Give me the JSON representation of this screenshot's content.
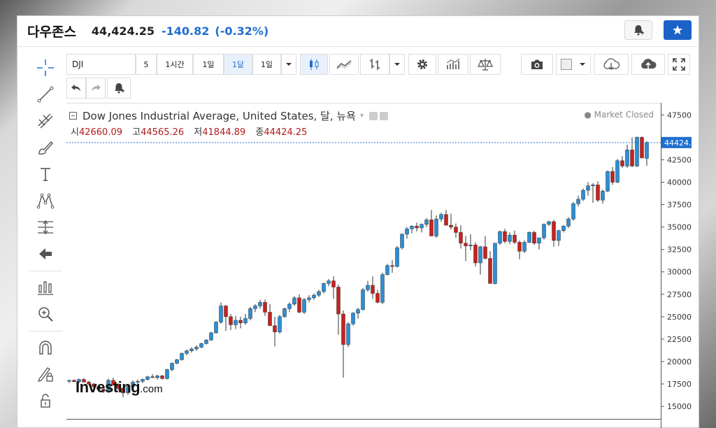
{
  "header": {
    "title": "다우존스",
    "price": "44,424.25",
    "change": "-140.82",
    "change_pct": "(-0.32%)"
  },
  "toolbar": {
    "symbol": "DJI",
    "intervals": [
      "5",
      "1시간",
      "1일",
      "1달",
      "1일"
    ],
    "active_interval": "1달"
  },
  "icons": [
    "crosshair-icon",
    "trend-line-icon",
    "fib-icon",
    "brush-icon",
    "text-icon",
    "pattern-icon",
    "measure-icon",
    "arrow-left-icon",
    "indicators-icon",
    "zoom-icon",
    "magnet-icon",
    "lock-drawing-icon",
    "unlock-icon",
    "undo-icon",
    "redo-icon",
    "alert-icon",
    "star-icon",
    "candles-icon",
    "line-icon",
    "bars-icon",
    "settings-icon",
    "studies-icon",
    "compare-icon",
    "camera-icon",
    "color-icon",
    "cloud-load-icon",
    "cloud-save-icon",
    "fullscreen-icon"
  ],
  "legend": {
    "title": "Dow Jones Industrial Average, United States, 달, 뉴욕",
    "market_status": "Market Closed",
    "open_label": "시",
    "open": "42660.09",
    "high_label": "고",
    "high": "44565.26",
    "low_label": "저",
    "low": "41844.89",
    "close_label": "종",
    "close": "44424.25"
  },
  "brand": {
    "name": "Investing",
    "suffix": ".com"
  },
  "colors": {
    "up": "#2a8fd6",
    "down": "#c8211d",
    "accent": "#1b62c7"
  },
  "chart_data": {
    "type": "candlestick",
    "title": "Dow Jones Industrial Average, United States, 달, 뉴욕",
    "y_ticks": [
      "15000.00",
      "17500.00",
      "20000.00",
      "22500.00",
      "25000.00",
      "27500.00",
      "30000.00",
      "32500.00",
      "35000.00",
      "37500.00",
      "40000.00",
      "42500.00",
      "47500.00"
    ],
    "ylim": [
      13600,
      48700
    ],
    "last_price_label": "44424.25",
    "candles": [
      [
        17800,
        17950,
        17600,
        17900
      ],
      [
        17900,
        18000,
        17700,
        17750
      ],
      [
        17750,
        18100,
        17600,
        18000
      ],
      [
        18000,
        18150,
        17850,
        17700
      ],
      [
        17700,
        17850,
        17400,
        17500
      ],
      [
        17500,
        17600,
        17100,
        17200
      ],
      [
        17200,
        17300,
        16800,
        16900
      ],
      [
        16900,
        17000,
        16500,
        16700
      ],
      [
        16700,
        18100,
        16500,
        17900
      ],
      [
        17900,
        18200,
        17700,
        17400
      ],
      [
        17400,
        17600,
        16800,
        17000
      ],
      [
        17000,
        17200,
        16000,
        16500
      ],
      [
        16500,
        17400,
        16300,
        17200
      ],
      [
        17200,
        17900,
        17000,
        17700
      ],
      [
        17700,
        18000,
        17500,
        17800
      ],
      [
        17800,
        18100,
        17600,
        18000
      ],
      [
        18000,
        18400,
        17900,
        18300
      ],
      [
        18300,
        18600,
        18200,
        18200
      ],
      [
        18200,
        18500,
        18000,
        18400
      ],
      [
        18400,
        18500,
        18000,
        18100
      ],
      [
        18100,
        19200,
        18000,
        19100
      ],
      [
        19100,
        19900,
        18900,
        19800
      ],
      [
        19800,
        20300,
        19700,
        20200
      ],
      [
        20200,
        21000,
        20100,
        20900
      ],
      [
        20900,
        21300,
        20700,
        21200
      ],
      [
        21200,
        21600,
        21000,
        21400
      ],
      [
        21400,
        21800,
        21200,
        21600
      ],
      [
        21600,
        22100,
        21500,
        22000
      ],
      [
        22000,
        22500,
        21900,
        22400
      ],
      [
        22400,
        23300,
        22300,
        23200
      ],
      [
        23200,
        24500,
        23100,
        24400
      ],
      [
        24400,
        26600,
        24200,
        26200
      ],
      [
        26200,
        26300,
        23400,
        25000
      ],
      [
        25000,
        25300,
        23500,
        24100
      ],
      [
        24100,
        25100,
        23600,
        24600
      ],
      [
        24600,
        25000,
        23700,
        24300
      ],
      [
        24300,
        25300,
        24100,
        24800
      ],
      [
        24800,
        26100,
        24600,
        25900
      ],
      [
        25900,
        26400,
        25500,
        26200
      ],
      [
        26200,
        26900,
        25900,
        26600
      ],
      [
        26600,
        26900,
        25100,
        25500
      ],
      [
        25500,
        26400,
        24400,
        24000
      ],
      [
        24000,
        25000,
        21700,
        23300
      ],
      [
        23300,
        25200,
        23100,
        25000
      ],
      [
        25000,
        26000,
        24900,
        25900
      ],
      [
        25900,
        26600,
        25500,
        26400
      ],
      [
        26400,
        27300,
        26200,
        27100
      ],
      [
        27100,
        27500,
        25400,
        25500
      ],
      [
        25500,
        27100,
        25300,
        26900
      ],
      [
        26900,
        27400,
        26600,
        27100
      ],
      [
        27100,
        27600,
        26900,
        27400
      ],
      [
        27400,
        28000,
        27200,
        27800
      ],
      [
        27800,
        28800,
        27600,
        28700
      ],
      [
        28700,
        29200,
        28400,
        29000
      ],
      [
        29000,
        29500,
        27000,
        28300
      ],
      [
        28300,
        28600,
        23000,
        25300
      ],
      [
        25300,
        25700,
        18200,
        21900
      ],
      [
        21900,
        24400,
        21600,
        24200
      ],
      [
        24200,
        25500,
        24000,
        25400
      ],
      [
        25400,
        26000,
        24800,
        25800
      ],
      [
        25800,
        28200,
        25700,
        28000
      ],
      [
        28000,
        29000,
        27800,
        28500
      ],
      [
        28500,
        29500,
        27000,
        27600
      ],
      [
        27600,
        28000,
        26500,
        26600
      ],
      [
        26600,
        29900,
        26400,
        29700
      ],
      [
        29700,
        30900,
        29600,
        30700
      ],
      [
        30700,
        31300,
        29900,
        30600
      ],
      [
        30600,
        32900,
        30500,
        32700
      ],
      [
        32700,
        34300,
        32500,
        34200
      ],
      [
        34200,
        35000,
        33700,
        34800
      ],
      [
        34800,
        35200,
        34300,
        35100
      ],
      [
        35100,
        35500,
        34500,
        34900
      ],
      [
        34900,
        35400,
        34400,
        35300
      ],
      [
        35300,
        36000,
        35000,
        35800
      ],
      [
        35800,
        36900,
        35500,
        34000
      ],
      [
        34000,
        36300,
        33800,
        35900
      ],
      [
        35900,
        36600,
        35600,
        36400
      ],
      [
        36400,
        36900,
        35800,
        35200
      ],
      [
        35200,
        36500,
        34700,
        35000
      ],
      [
        35000,
        35400,
        33800,
        34400
      ],
      [
        34400,
        35200,
        32600,
        33200
      ],
      [
        33200,
        34000,
        31200,
        32900
      ],
      [
        32900,
        34200,
        32400,
        33000
      ],
      [
        33000,
        33300,
        30600,
        31000
      ],
      [
        31000,
        32900,
        29700,
        32800
      ],
      [
        32800,
        34000,
        31400,
        31500
      ],
      [
        31500,
        32300,
        28700,
        28700
      ],
      [
        28700,
        33000,
        28600,
        33200
      ],
      [
        33200,
        34600,
        33000,
        34500
      ],
      [
        34500,
        34800,
        33200,
        33400
      ],
      [
        33400,
        34400,
        33100,
        34100
      ],
      [
        34100,
        34600,
        33100,
        33300
      ],
      [
        33300,
        33500,
        31400,
        32300
      ],
      [
        32300,
        33500,
        32100,
        33300
      ],
      [
        33300,
        34500,
        33200,
        34400
      ],
      [
        34400,
        34600,
        33000,
        33200
      ],
      [
        33200,
        33700,
        32500,
        33800
      ],
      [
        33800,
        35400,
        33600,
        35300
      ],
      [
        35300,
        35700,
        35100,
        35600
      ],
      [
        35600,
        35800,
        32800,
        33500
      ],
      [
        33500,
        34700,
        32900,
        34600
      ],
      [
        34600,
        35200,
        34400,
        35100
      ],
      [
        35100,
        36100,
        34900,
        35900
      ],
      [
        35900,
        37800,
        35700,
        37600
      ],
      [
        37600,
        38500,
        37300,
        38100
      ],
      [
        38100,
        39300,
        37900,
        39100
      ],
      [
        39100,
        40000,
        38500,
        39600
      ],
      [
        39600,
        39900,
        37700,
        39700
      ],
      [
        39700,
        40100,
        37800,
        38000
      ],
      [
        38000,
        39200,
        37600,
        39000
      ],
      [
        39000,
        41300,
        38900,
        41200
      ],
      [
        41200,
        41700,
        39700,
        40000
      ],
      [
        40000,
        42600,
        39900,
        42400
      ],
      [
        42400,
        42900,
        41600,
        41800
      ],
      [
        41800,
        44200,
        41600,
        43600
      ],
      [
        43600,
        45000,
        41700,
        41800
      ],
      [
        41800,
        45100,
        41700,
        45000
      ],
      [
        45000,
        45100,
        42800,
        42700
      ],
      [
        42660,
        44565,
        41845,
        44424
      ]
    ]
  }
}
